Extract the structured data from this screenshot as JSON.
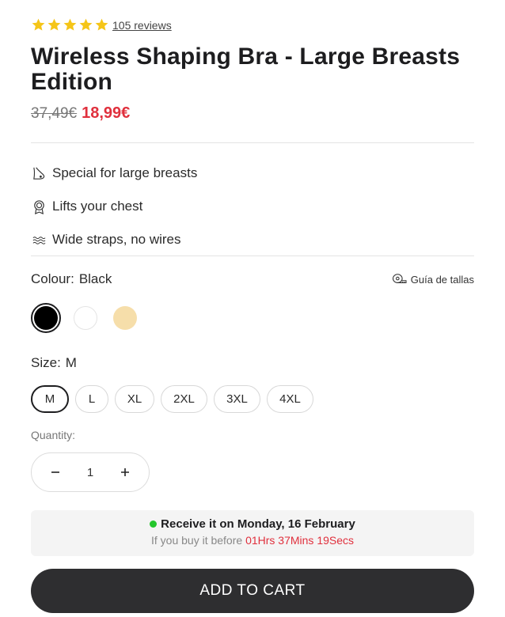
{
  "rating": {
    "stars": 5,
    "star_color": "#f5c518",
    "reviews_label": "105 reviews"
  },
  "product": {
    "title": "Wireless Shaping Bra - Large Breasts Edition",
    "old_price": "37,49€",
    "new_price": "18,99€",
    "sale_color": "#e0303d"
  },
  "features": [
    {
      "icon": "breast-icon",
      "text": "Special for large breasts"
    },
    {
      "icon": "badge-icon",
      "text": "Lifts your chest"
    },
    {
      "icon": "waves-icon",
      "text": "Wide straps, no wires"
    }
  ],
  "colour": {
    "label": "Colour:",
    "selected": "Black",
    "size_guide_label": "Guía de tallas",
    "swatches": [
      {
        "name": "Black",
        "hex": "#000000",
        "selected": true
      },
      {
        "name": "White",
        "hex": "#ffffff",
        "selected": false
      },
      {
        "name": "Beige",
        "hex": "#f6deaa",
        "selected": false
      }
    ]
  },
  "size": {
    "label": "Size:",
    "selected": "M",
    "options": [
      "M",
      "L",
      "XL",
      "2XL",
      "3XL",
      "4XL"
    ]
  },
  "quantity": {
    "label": "Quantity:",
    "value": "1"
  },
  "delivery": {
    "headline": "Receive it on Monday, 16 February",
    "prefix": "If you buy it before",
    "timer": "01Hrs 37Mins 19Secs",
    "status_color": "#23c62b"
  },
  "cart": {
    "button_label": "ADD TO CART",
    "button_color": "#2e2e30"
  }
}
